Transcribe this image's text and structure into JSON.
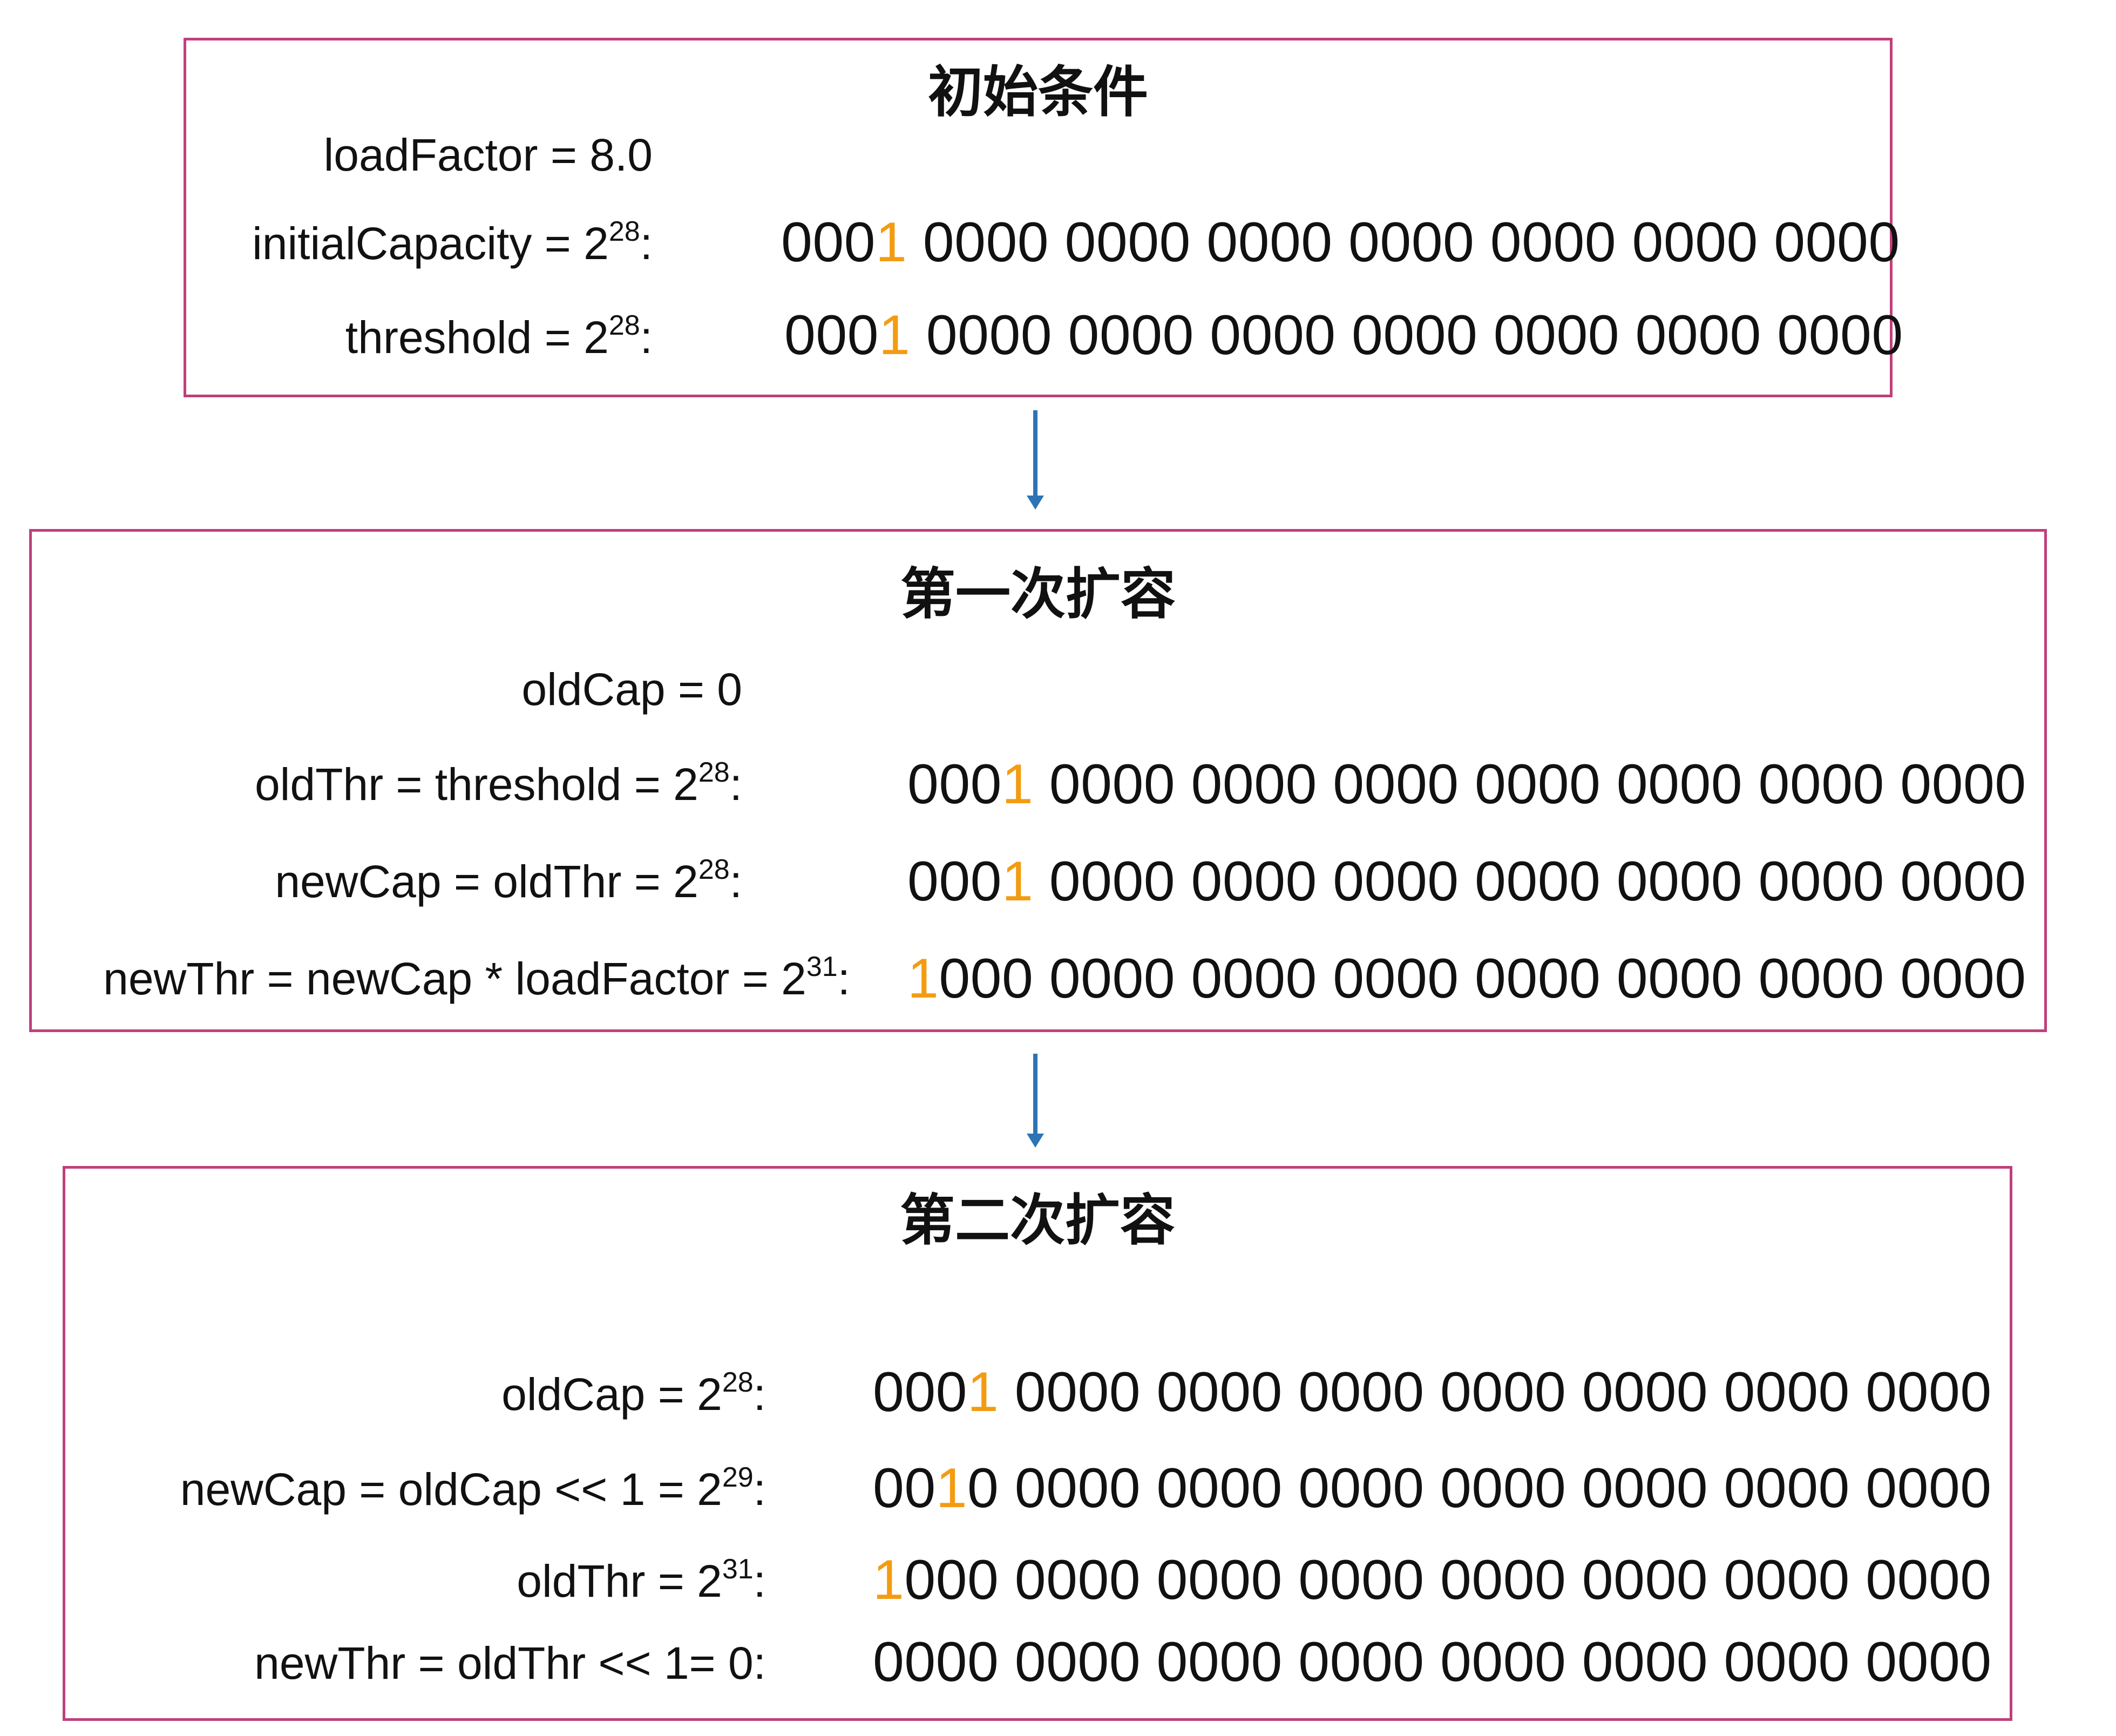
{
  "panels": [
    {
      "title": "初始条件",
      "rows": [
        {
          "label": "loadFactor = 8.0"
        },
        {
          "label": "initialCapacity = 2",
          "label_exp": "28",
          "label_tail": ":",
          "binary_pre": "000",
          "binary_hl": "1",
          "binary_post": " 0000 0000 0000 0000 0000 0000 0000"
        },
        {
          "label": "threshold = 2",
          "label_exp": "28",
          "label_tail": ":",
          "binary_pre": "000",
          "binary_hl": "1",
          "binary_post": " 0000 0000 0000 0000 0000 0000 0000"
        }
      ]
    },
    {
      "title": "第一次扩容",
      "rows": [
        {
          "label": "oldCap = 0"
        },
        {
          "label": "oldThr = threshold = 2",
          "label_exp": "28",
          "label_tail": ":",
          "binary_pre": "000",
          "binary_hl": "1",
          "binary_post": " 0000 0000 0000 0000 0000 0000 0000"
        },
        {
          "label": "newCap = oldThr = 2",
          "label_exp": "28",
          "label_tail": ":",
          "binary_pre": "000",
          "binary_hl": "1",
          "binary_post": " 0000 0000 0000 0000 0000 0000 0000"
        },
        {
          "label": "newThr = newCap * loadFactor = 2",
          "label_exp": "31",
          "label_tail": ":",
          "binary_pre": "",
          "binary_hl": "1",
          "binary_post": "000 0000 0000 0000 0000 0000 0000 0000"
        }
      ]
    },
    {
      "title": "第二次扩容",
      "rows": [
        {
          "label": "oldCap = 2",
          "label_exp": "28",
          "label_tail": ":",
          "binary_pre": "000",
          "binary_hl": "1",
          "binary_post": " 0000 0000 0000 0000 0000 0000 0000"
        },
        {
          "label": "newCap = oldCap << 1 = 2",
          "label_exp": "29",
          "label_tail": ":",
          "binary_pre": "00",
          "binary_hl": "1",
          "binary_post": "0 0000 0000 0000 0000 0000 0000 0000"
        },
        {
          "label": "oldThr = 2",
          "label_exp": "31",
          "label_tail": ":",
          "binary_pre": "",
          "binary_hl": "1",
          "binary_post": "000 0000 0000 0000 0000 0000 0000 0000"
        },
        {
          "label": "newThr = oldThr << 1= 0:",
          "binary_pre": "0000 0000 0000 0000 0000 0000 0000 0000"
        }
      ]
    }
  ],
  "colors": {
    "border": "#c03f7c",
    "highlight": "#f39c12",
    "arrow": "#2e74b5"
  }
}
